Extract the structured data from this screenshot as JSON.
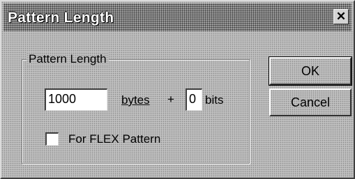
{
  "dialog": {
    "title": "Pattern Length",
    "close_glyph": "✕"
  },
  "group": {
    "title": "Pattern Length",
    "bytes_value": "1000",
    "bytes_label": "bytes",
    "plus": "+",
    "bits_value": "0",
    "bits_label": "bits",
    "flex_checkbox_checked": false,
    "flex_label": "For FLEX Pattern"
  },
  "buttons": {
    "ok": "OK",
    "cancel": "Cancel"
  },
  "icons": {
    "close": "close-icon"
  }
}
